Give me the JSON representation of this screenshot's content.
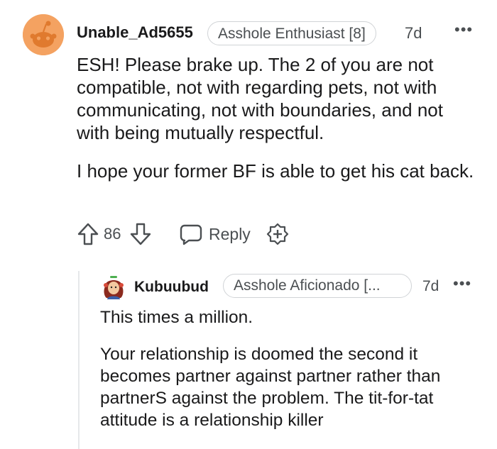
{
  "comment": {
    "username": "Unable_Ad5655",
    "flair": "Asshole Enthusiast [8]",
    "time": "7d",
    "more": "•••",
    "paragraphs": [
      "ESH! Please brake up. The 2 of you are not compatible, not with regarding pets, not with communicating, not with boundaries, and not with being mutually respectful.",
      "I hope your former BF is able to get his cat back."
    ],
    "score": "86",
    "reply_label": "Reply",
    "icons": {
      "avatar": "snoo-avatar-icon",
      "upvote": "upvote-arrow-icon",
      "downvote": "downvote-arrow-icon",
      "reply": "chat-bubble-icon",
      "award": "award-plus-icon",
      "more": "overflow-dots-icon"
    },
    "colors": {
      "avatar_bg": "#f4a261"
    }
  },
  "reply": {
    "username": "Kubuubud",
    "flair": "Asshole Aficionado [...",
    "time": "7d",
    "more": "•••",
    "paragraphs": [
      "This times a million.",
      "Your relationship is doomed the second it becomes partner against partner rather than partnerS against the problem. The tit-for-tat attitude is a relationship killer"
    ],
    "icons": {
      "avatar": "custom-avatar-icon",
      "more": "overflow-dots-icon"
    }
  }
}
